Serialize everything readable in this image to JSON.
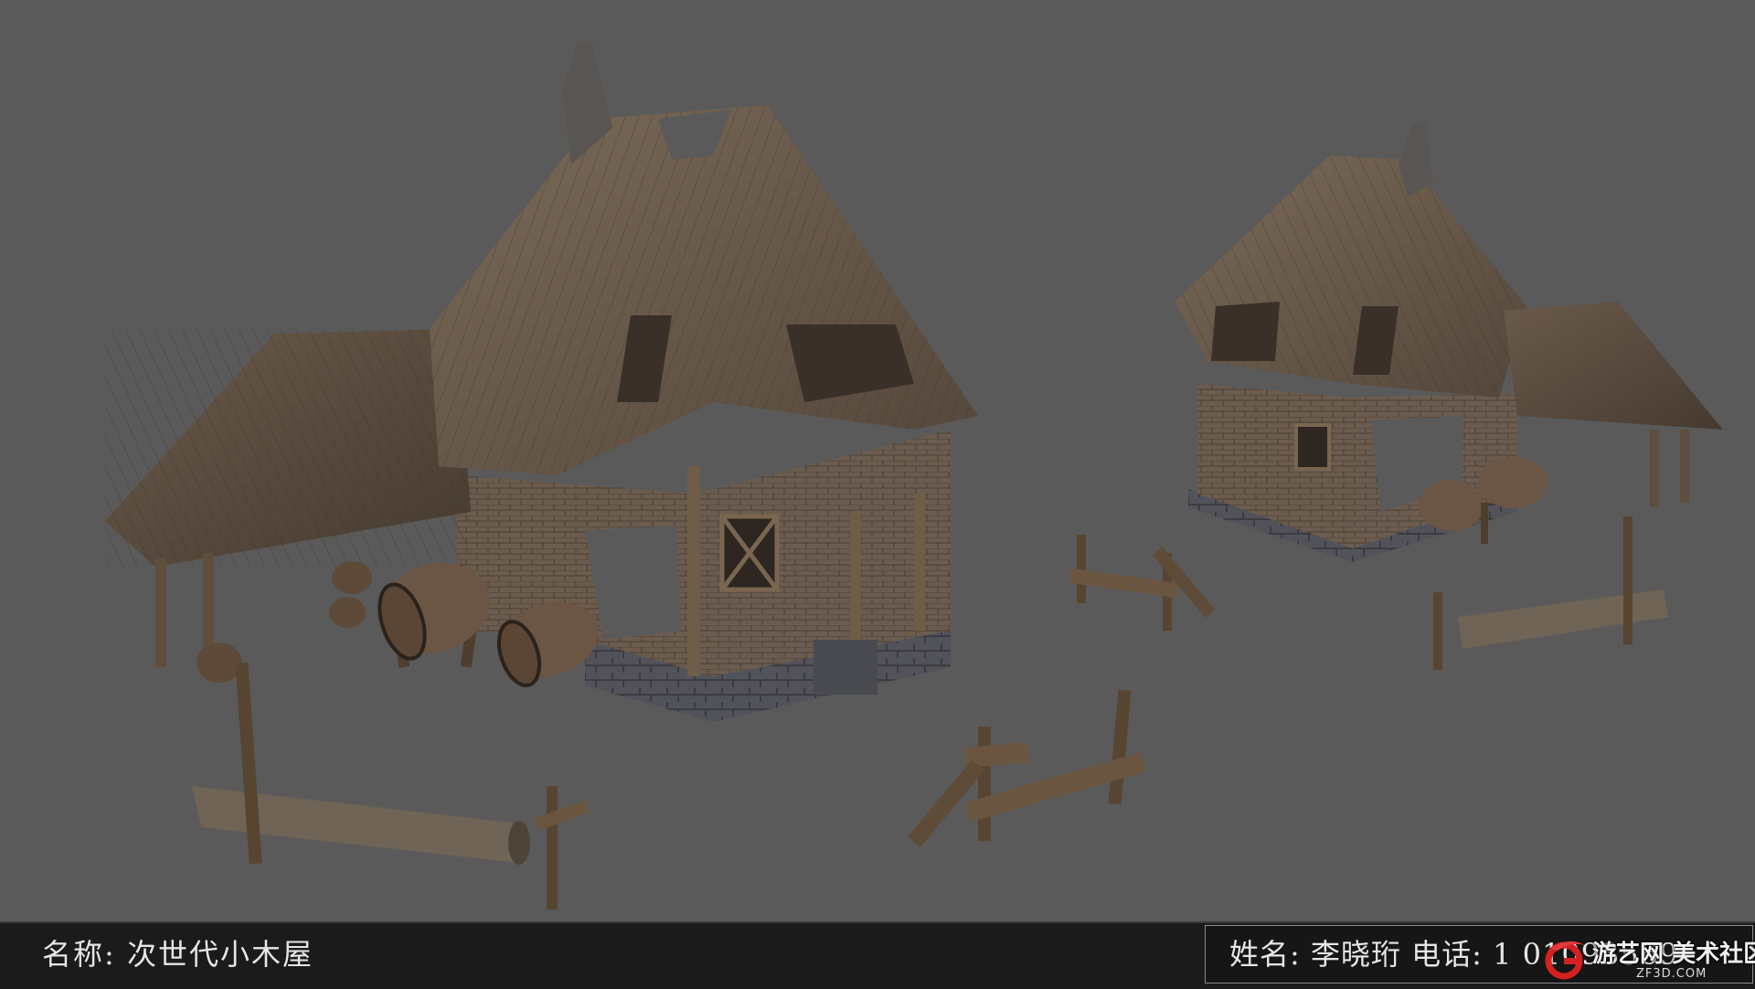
{
  "caption": {
    "name_text": "名称: 次世代小木屋",
    "author_text": "姓名: 李晓珩 电话: 1  01093569"
  },
  "watermark": {
    "site_name": "游艺网",
    "community": "美术社区",
    "url": "ZF3D.COM"
  },
  "colors": {
    "background": "#5a5a5a",
    "roof_wood": "#6b5a48",
    "brick_wall": "#6e5e50",
    "stone_base": "#4e4f56",
    "bar": "#1b1b1b",
    "logo_red": "#d32020"
  },
  "scene": {
    "objects": [
      "large-cabin",
      "small-cabin",
      "barrels",
      "broken-fences",
      "logs"
    ]
  }
}
